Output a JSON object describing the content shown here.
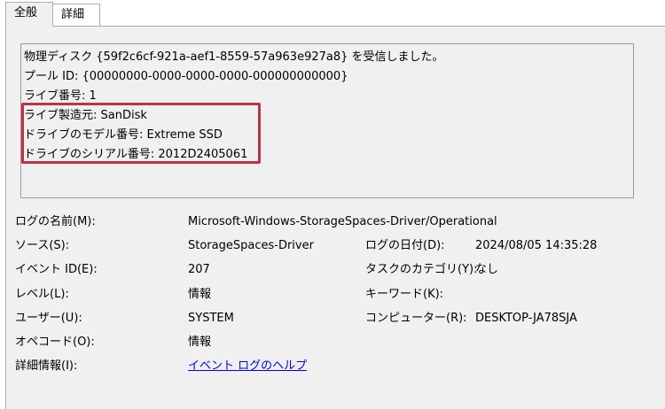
{
  "tabs": [
    {
      "label": "全般"
    },
    {
      "label": "詳細"
    }
  ],
  "description": {
    "lines": [
      "物理ディスク {59f2c6cf-921a-aef1-8559-57a963e927a8} を受信しました。",
      "プール ID: {00000000-0000-0000-0000-000000000000}",
      "ライブ番号: 1",
      "ライブ製造元: SanDisk",
      "ドライブのモデル番号: Extreme SSD",
      "ドライブのシリアル番号: 2012D2405061"
    ]
  },
  "fields": {
    "log_name_label": "ログの名前(M):",
    "log_name_value": "Microsoft-Windows-StorageSpaces-Driver/Operational",
    "source_label": "ソース(S):",
    "source_value": "StorageSpaces-Driver",
    "logged_label": "ログの日付(D):",
    "logged_value": "2024/08/05 14:35:28",
    "event_id_label": "イベント ID(E):",
    "event_id_value": "207",
    "task_category_label": "タスクのカテゴリ(Y):",
    "task_category_value": "なし",
    "level_label": "レベル(L):",
    "level_value": "情報",
    "keywords_label": "キーワード(K):",
    "user_label": "ユーザー(U):",
    "user_value": "SYSTEM",
    "computer_label": "コンピューター(R):",
    "computer_value": "DESKTOP-JA78SJA",
    "opcode_label": "オペコード(O):",
    "opcode_value": "情報",
    "more_info_label": "詳細情報(I):",
    "more_info_link": "イベント ログのヘルプ"
  },
  "colors": {
    "highlight_border": "#c0304b",
    "link": "#0000ee",
    "panel_background": "#f0f0f0"
  }
}
